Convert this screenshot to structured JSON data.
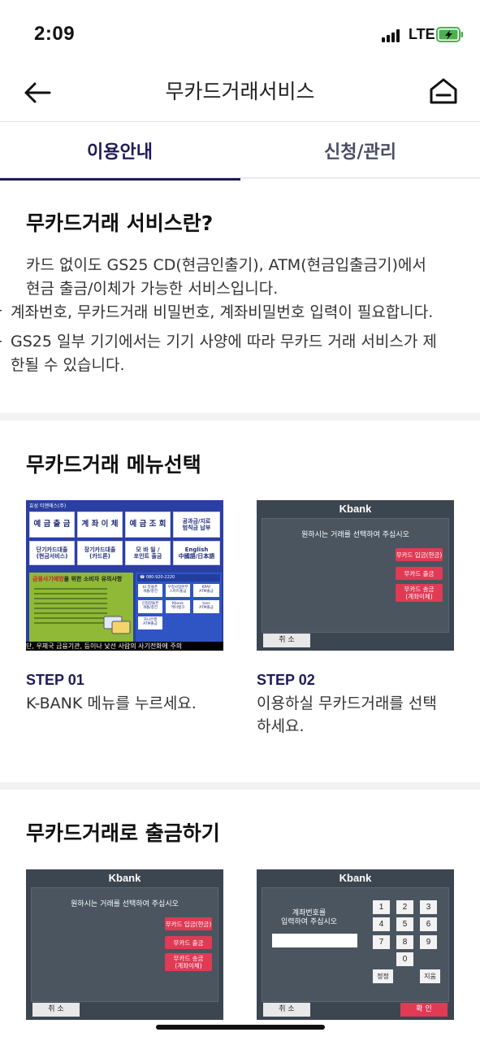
{
  "status_bar": {
    "time": "2:09",
    "network": "LTE"
  },
  "header": {
    "title": "무카드거래서비스",
    "back_icon": "arrow-left-icon",
    "home_icon": "home-icon"
  },
  "tabs": [
    {
      "label": "이용안내",
      "active": true
    },
    {
      "label": "신청/관리",
      "active": false
    }
  ],
  "intro": {
    "title": "무카드거래 서비스란?",
    "description_line1": "카드 없이도 GS25 CD(현금인출기), ATM(현금입출금기)에서",
    "description_line2": "현금 출금/이체가 가능한 서비스입니다.",
    "bullet1": "계좌번호, 무카드거래 비밀번호, 계좌비밀번호 입력이 필요합니다.",
    "bullet2_line1": "GS25 일부 기기에서는 기기 사양에 따라 무카드 거래 서비스가 제",
    "bullet2_line2": "한될 수 있습니다."
  },
  "menu_select": {
    "title": "무카드거래 메뉴선택",
    "steps": [
      {
        "label": "STEP 01",
        "desc_line1": "K-BANK 메뉴를 누르세요.",
        "desc_line2": "",
        "kiosk": {
          "brand": "효성 티앤에스(주)",
          "buttons": [
            "예 금 출 금",
            "계 좌 이 체",
            "예 금 조 회",
            "공과금/지로\n범칙금 납부",
            "단기카드대출\n(현금서비스)",
            "장기카드대출\n(카드론)",
            "모 바 일 /\n포인트 출금",
            "English\n中國語/日本語"
          ],
          "notice_prefix": "금융사기예방",
          "notice_suffix": "을 위한 소비자 유의사항",
          "mini_buttons": [
            "kt 알뜰폰\n개통/충전",
            "우정사업본부\n스마트출금",
            "KPAY\nATM출금",
            "신협알뜰폰\n개통/충전",
            "Kbank\n케이뱅크",
            "toss\nATM출금",
            "하나은행\nATM출금"
          ],
          "ticker": "단, 우체국 금융기관, 등이나 낯선 사람의 사기전화에 주의"
        }
      },
      {
        "label": "STEP 02",
        "desc_line1": "이용하실 무카드거래를 선택",
        "desc_line2": "하세요.",
        "screen": {
          "brand": "Kbank",
          "message": "원하시는 거래를 선택하여 주십시오",
          "options": [
            "무카드 입금(현금)",
            "무카드 출금",
            "무카드 송금\n(계좌이체)"
          ],
          "cancel": "취  소"
        }
      }
    ]
  },
  "withdraw": {
    "title": "무카드거래로 출금하기",
    "screens": [
      {
        "brand": "Kbank",
        "message": "원하시는 거래를 선택하여 주십시오",
        "options": [
          "무카드 입금(현금)",
          "무카드 출금",
          "무카드 송금\n(계좌이체)"
        ],
        "cancel": "취  소"
      },
      {
        "brand": "Kbank",
        "message_line1": "계좌번호를",
        "message_line2": "입력하여 주십시오",
        "keys": [
          "1",
          "2",
          "3",
          "4",
          "5",
          "6",
          "7",
          "8",
          "9",
          "0"
        ],
        "correct": "정정",
        "clear": "지움",
        "cancel": "취  소",
        "confirm": "확  인"
      }
    ]
  },
  "colors": {
    "accent": "#1e1a5a",
    "atm_bg": "#3c4651",
    "atm_button": "#e03a55"
  }
}
